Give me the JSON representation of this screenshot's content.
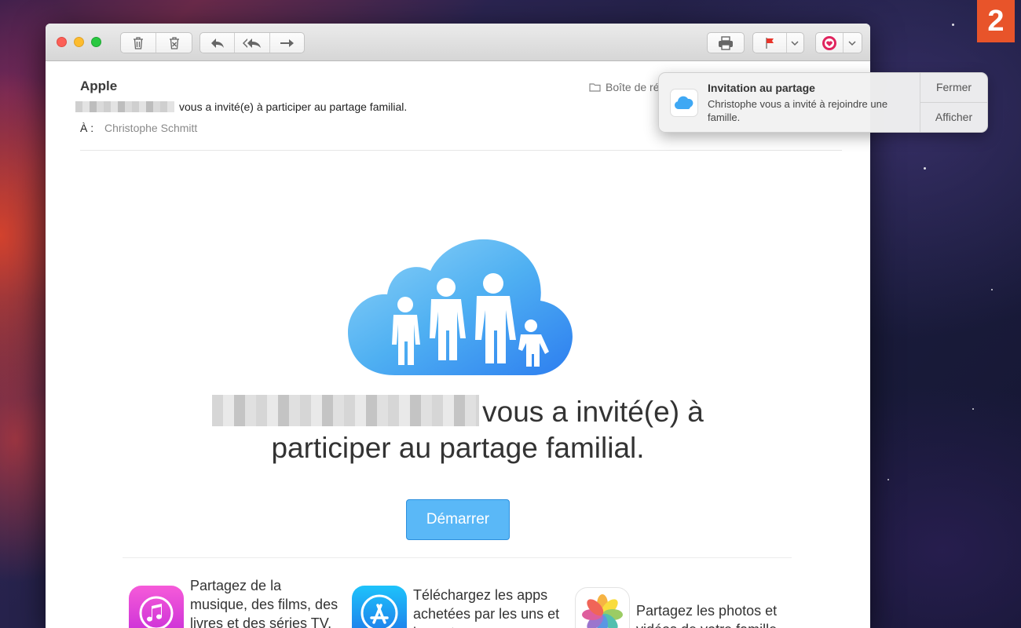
{
  "badge": "2",
  "toolbar": {
    "trash_icon": "trash-icon",
    "junk_icon": "junk-icon",
    "reply_icon": "reply-icon",
    "reply_all_icon": "reply-all-icon",
    "forward_icon": "forward-icon",
    "print_icon": "print-icon",
    "flag_icon": "flag-icon",
    "flag_color": "#e8342a"
  },
  "message": {
    "sender": "Apple",
    "mailbox": "Boîte de ré",
    "subject_suffix": "vous a invité(e) à participer au partage familial.",
    "to_label": "À :",
    "to_name": "Christophe Schmitt"
  },
  "body": {
    "headline_line1_suffix": "vous a invité(e) à",
    "headline_line2": "participer au partage familial.",
    "cta_label": "Démarrer",
    "cta_color": "#5ab8f7"
  },
  "features": [
    {
      "icon": "itunes-icon",
      "text": "Partagez de la musique, des films, des livres et des séries TV."
    },
    {
      "icon": "app-store-icon",
      "text": "Téléchargez les apps achetées par les uns et les autres."
    },
    {
      "icon": "photos-icon",
      "text": "Partagez les photos et vidéos de votre famille"
    }
  ],
  "notification": {
    "icon": "icloud-icon",
    "title": "Invitation au partage",
    "body": "Christophe vous a invité à rejoindre une famille.",
    "close_label": "Fermer",
    "show_label": "Afficher"
  }
}
